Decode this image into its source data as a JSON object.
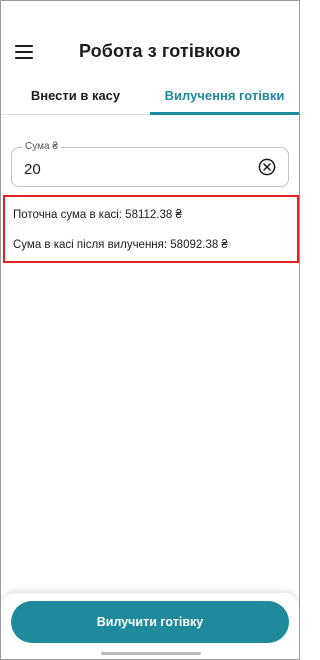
{
  "header": {
    "title": "Робота з готівкою",
    "menu_icon": "hamburger-menu-icon"
  },
  "tabs": [
    {
      "label": "Внести в касу",
      "active": false
    },
    {
      "label": "Вилучення готівки",
      "active": true
    }
  ],
  "amount": {
    "label": "Сума ₴",
    "value": "20",
    "clear_icon": "clear-circle-x-icon"
  },
  "info": {
    "current_sum": "Поточна сума в касі: 58112.38 ₴",
    "sum_after": "Сума в касі після вилучення: 58092.38 ₴"
  },
  "actions": {
    "withdraw_label": "Вилучити готівку"
  },
  "colors": {
    "accent": "#1f8a9c",
    "highlight_border": "#e0201f"
  }
}
